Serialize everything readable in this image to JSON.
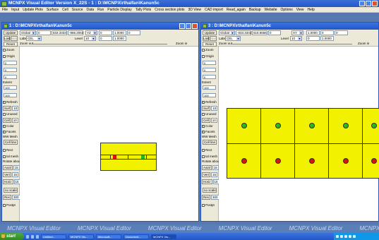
{
  "app": {
    "title": "MCNPX Visual Editor Version X_22S  -  1 : D:\\MCNPX\\rthalfan\\Kanun5c"
  },
  "menu": [
    "File",
    "Input",
    "Update Plots",
    "Surface",
    "Cell",
    "Source",
    "Data",
    "Run",
    "Particle Display",
    "Tally Plots",
    "Cross section plots",
    "3D View",
    "CAD import",
    "Read_again",
    "Backup",
    "Website",
    "Options",
    "View",
    "Help"
  ],
  "windows": [
    {
      "title": "1 : D:\\MCNPX\\rthalfan\\Kanun5c",
      "update": "Update",
      "lastlbl": "Last",
      "nextlbl": "Next",
      "reset": "Reset",
      "view_select": "Global",
      "origin_x": "0",
      "origin_y": "833.3333",
      "origin_z": "-966.2063",
      "plane_select": "YZ",
      "extent_1": "0",
      "extent_2": "1.0000",
      "extent_3": "0",
      "label_select": "CEL",
      "level_select": "10",
      "extent_4": "0",
      "extent_5": "1.0000",
      "label_label": "Label",
      "level_label": "Level",
      "zoom_out": "Zoom out",
      "zoom_in": "Zoom in"
    },
    {
      "title": "3 : D:\\MCNPX\\rthalfan\\Kanun5c",
      "update": "Update",
      "lastlbl": "Last",
      "nextlbl": "Next",
      "reset": "Reset",
      "view_select": "Global",
      "origin_x": "-833.3333",
      "origin_y": "516.6656",
      "origin_z": "0",
      "plane_select": "XY",
      "extent_1": "1.0000",
      "extent_2": "0",
      "extent_3": "0",
      "label_select": "CEL",
      "level_select": "10",
      "extent_4": "0",
      "extent_5": "1.0000",
      "label_label": "Label",
      "level_label": "Level",
      "zoom_out": "Zoom out",
      "zoom_in": "Zoom in"
    }
  ],
  "panel": {
    "zoom": "Zoom",
    "origin": "Origin",
    "extent": "Extent",
    "ext1": "1",
    "val_a": "0",
    "val_b": "0",
    "val_c": "0",
    "val_ext": "100",
    "val_ext2": "100",
    "refresh": "Refresh",
    "surf": "Surf",
    "surf_val": "10",
    "unused": "Unused",
    "cell": "Cell",
    "cell_val": "10",
    "color": "Color",
    "facets": "Facets",
    "ww_mesh": "WW Mesh",
    "cell_line": "Cell line",
    "rect": "Rect",
    "tal_mesh": "tal mesh",
    "rotate": "Rotate about",
    "axial": "Axial",
    "axial_val": "15",
    "vert": "Vert",
    "vert_val": "15",
    "horiz": "Horiz",
    "horiz_val": "15",
    "no_scale": "no scale",
    "res": "Res",
    "res_val": "300",
    "postpt": "Postpt"
  },
  "watermark": [
    "MCNPX Visual Editor",
    "MCNPX Visual Editor",
    "MCNPX Visual Editor",
    "MCNPX Visual Editor",
    "MCNPX Visual Editor",
    "MCNPX"
  ],
  "taskbar": {
    "start": "start",
    "tasks": [
      "Untitled...",
      "MCNPX Vis...",
      "Microsoft...",
      "Document...",
      "MCNPX Vis..."
    ]
  },
  "colors": {
    "geometry_fill": "#f2f200",
    "upper_marker": "#22bb22",
    "lower_marker": "#dd1111"
  }
}
